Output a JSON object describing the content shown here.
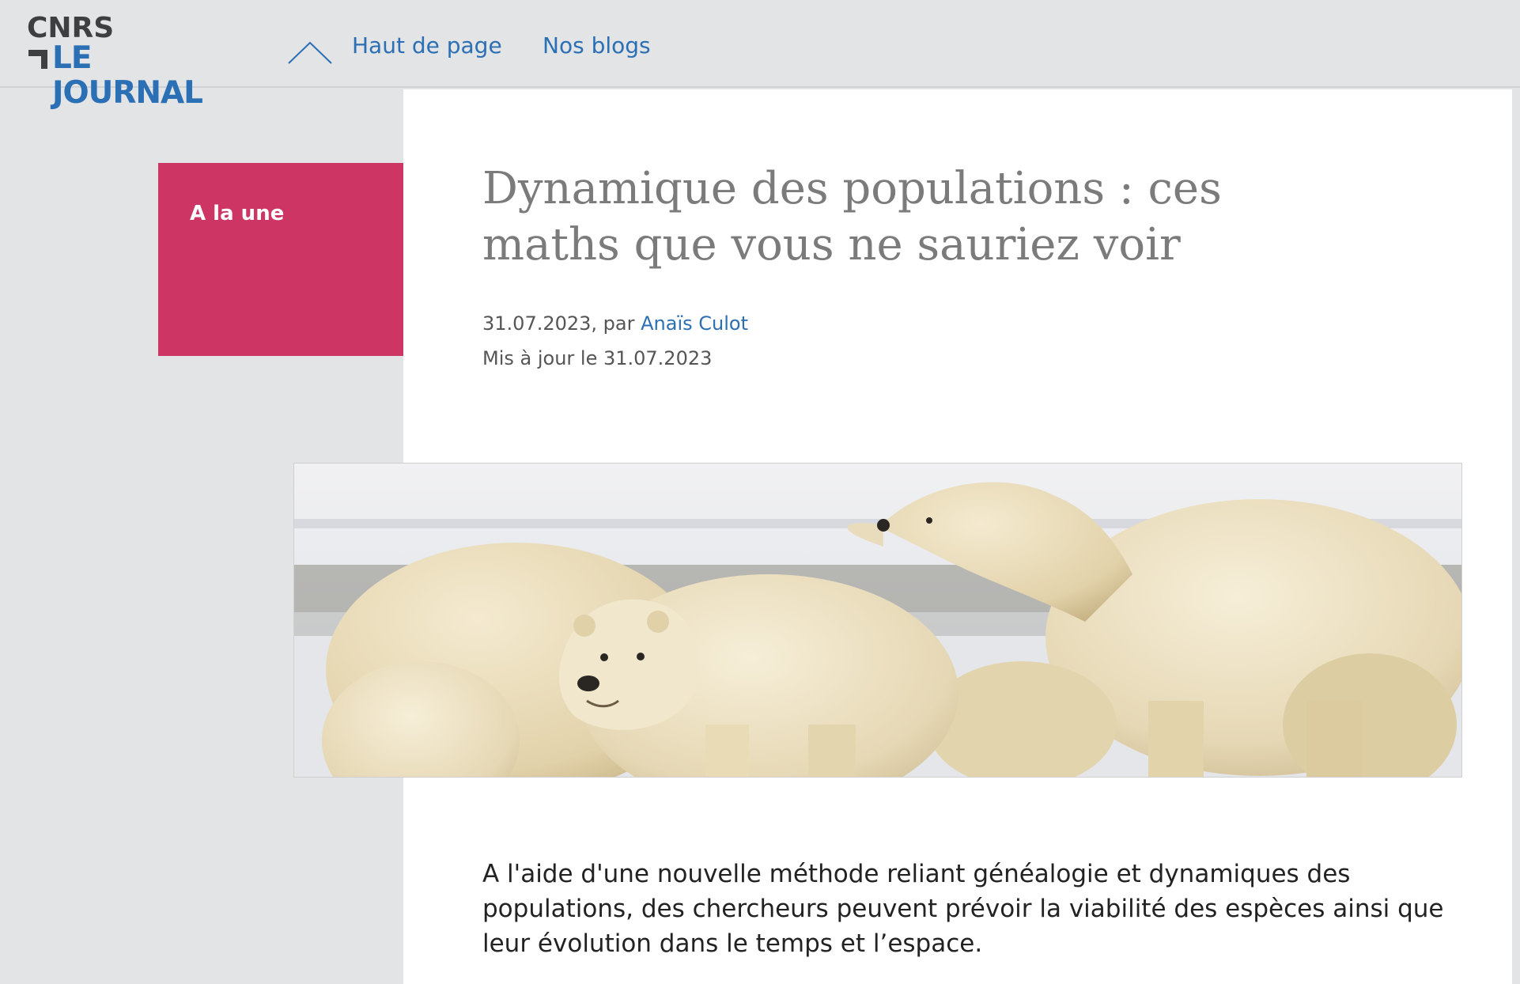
{
  "header": {
    "logo": {
      "top_text": "CNRS",
      "bottom_text": "LE JOURNAL",
      "brand_color": "#2b6fb4"
    },
    "nav": {
      "top_icon": "chevron-up-icon",
      "top_label": "Haut de page",
      "blogs_label": "Nos blogs"
    }
  },
  "rubric": {
    "label": "A la une",
    "color": "#cd3565"
  },
  "article": {
    "title": "Dynamique des populations : ces maths que vous ne sauriez voir",
    "date_prefix": "31.07.2023, par ",
    "author": "Anaïs Culot",
    "updated": "Mis à jour le 31.07.2023",
    "hero_image_subject": "polar bears",
    "lead": "A l'aide d'une nouvelle méthode reliant généalogie et dynamiques des populations, des chercheurs peuvent prévoir la viabilité des espèces ainsi que leur évolution dans le temps et l’espace."
  }
}
